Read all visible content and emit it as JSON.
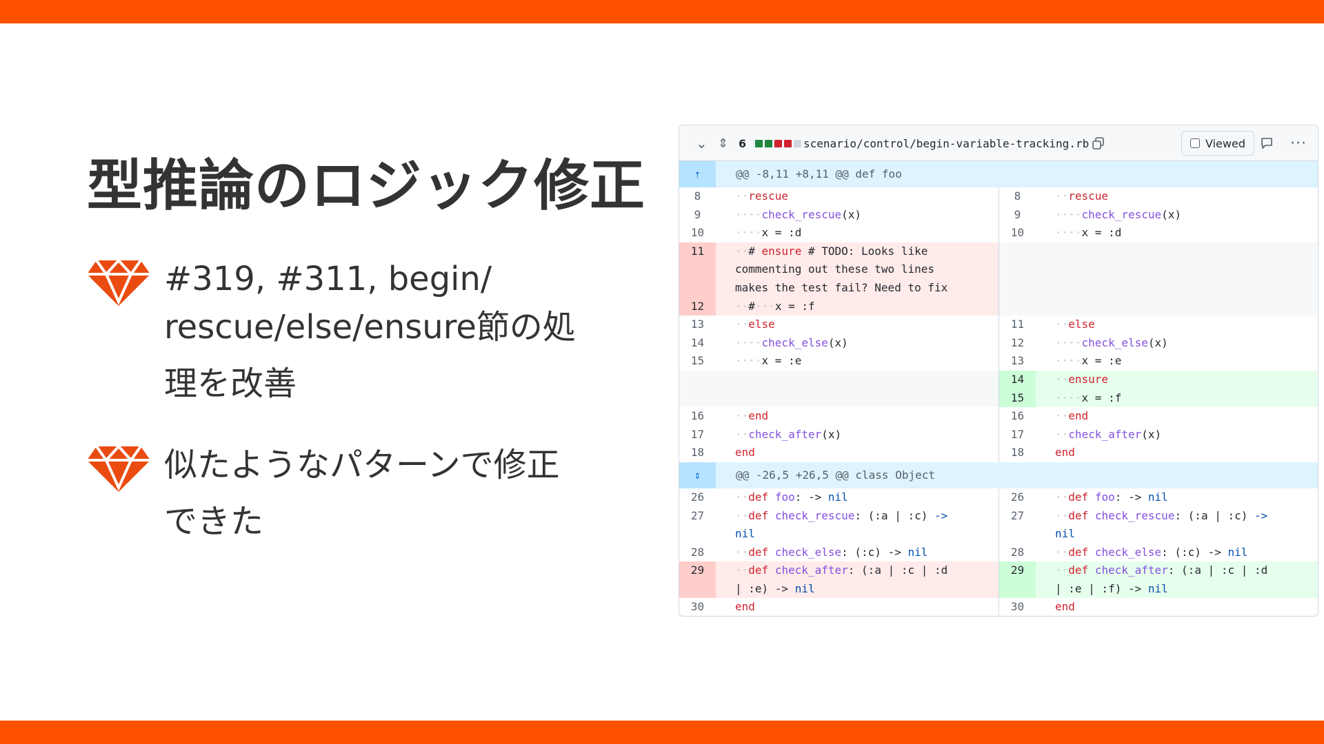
{
  "title": "型推論のロジック修正",
  "bullets": [
    {
      "icon": "ruby-gem-icon",
      "line1": "#319, #311, begin/",
      "line2": "rescue/else/ensure節の処",
      "line3": "理を改善"
    },
    {
      "icon": "ruby-gem-icon",
      "line1": "似たようなパターンで修正",
      "line2": "できた"
    }
  ],
  "colors": {
    "accent": "#ff5000",
    "gem": "#ea4b10",
    "del": "#ffebe9",
    "add": "#e6ffec",
    "hunk": "#ddf4ff"
  },
  "diff": {
    "changed_count": "6",
    "filename": "scenario/control/begin-variable-tracking.rb",
    "viewed_label": "Viewed",
    "hunk1": "@@ -8,11 +8,11 @@ def foo",
    "hunk2": "@@ -26,5 +26,5 @@ class Object",
    "rows1": [
      {
        "l": "8",
        "r": "8",
        "code": "··rescue"
      },
      {
        "l": "9",
        "r": "9",
        "code": "····check_rescue(x)"
      },
      {
        "l": "10",
        "r": "10",
        "code": "····x = :d"
      },
      {
        "l_top": "11",
        "l_bottom": "12",
        "del_lines": [
          "··# ensure # TODO: Looks like",
          "commenting out these two lines",
          "makes the test fail? Need to fix",
          "··#···x = :f"
        ]
      },
      {
        "l": "13",
        "r": "11",
        "code": "··else"
      },
      {
        "l": "14",
        "r": "12",
        "code": "····check_else(x)"
      },
      {
        "l": "15",
        "r": "13",
        "code": "····x = :e"
      },
      {
        "r": "14",
        "add": "··ensure"
      },
      {
        "r": "15",
        "add": "····x = :f"
      },
      {
        "l": "16",
        "r": "16",
        "code": "··end"
      },
      {
        "l": "17",
        "r": "17",
        "code": "··check_after(x)"
      },
      {
        "l": "18",
        "r": "18",
        "code": "end"
      }
    ],
    "rows2": [
      {
        "l": "26",
        "r": "26",
        "code": "··def foo: -> nil"
      },
      {
        "l": "27",
        "r": "27",
        "code1": "··def check_rescue: (:a | :c) ->",
        "code2": "nil"
      },
      {
        "l": "28",
        "r": "28",
        "code": "··def check_else: (:c) -> nil"
      },
      {
        "l": "29",
        "r": "29",
        "del1": "··def check_after: (:a | :c | :d",
        "del2": "| :e) -> nil",
        "add1": "··def check_after: (:a | :c | :d",
        "add2": "| :e | :f) -> nil"
      },
      {
        "l": "30",
        "r": "30",
        "code": "end"
      }
    ]
  }
}
